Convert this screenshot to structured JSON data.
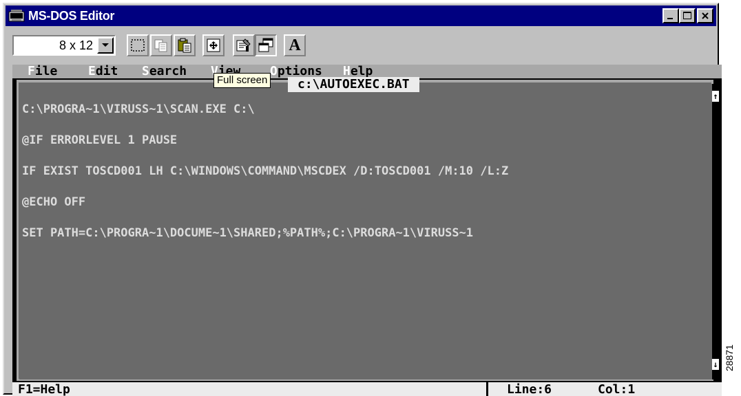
{
  "window": {
    "title": "MS-DOS Editor",
    "icon": "msdos-window-icon",
    "controls": {
      "minimize": "_",
      "maximize": "□",
      "close": "✕"
    }
  },
  "toolbar": {
    "font_size_value": "8 x 12",
    "buttons": [
      {
        "name": "mark-icon"
      },
      {
        "name": "copy-icon"
      },
      {
        "name": "paste-icon"
      },
      {
        "name": "full-screen-icon"
      },
      {
        "name": "properties-icon"
      },
      {
        "name": "background-icon"
      },
      {
        "name": "font-icon",
        "glyph": "A"
      }
    ],
    "tooltip": "Full screen"
  },
  "editor": {
    "menu": [
      {
        "hotkey": "F",
        "rest": "ile"
      },
      {
        "hotkey": "E",
        "rest": "dit"
      },
      {
        "hotkey": "S",
        "rest": "earch"
      },
      {
        "hotkey": "V",
        "rest": "iew"
      },
      {
        "hotkey": "O",
        "rest": "ptions"
      },
      {
        "hotkey": "H",
        "rest": "elp"
      }
    ],
    "file_title": "c:\\AUTOEXEC.BAT",
    "lines": [
      "C:\\PROGRA~1\\VIRUSS~1\\SCAN.EXE C:\\",
      "@IF ERRORLEVEL 1 PAUSE",
      "IF EXIST TOSCD001 LH C:\\WINDOWS\\COMMAND\\MSCDEX /D:TOSCD001 /M:10 /L:Z",
      "@ECHO OFF",
      "SET PATH=C:\\PROGRA~1\\DOCUME~1\\SHARED;%PATH%;C:\\PROGRA~1\\VIRUSS~1"
    ],
    "status": {
      "help": "F1=Help",
      "line": "Line:6",
      "col": "Col:1"
    }
  },
  "figure_id": "28871",
  "colors": {
    "titlebar": "#000080",
    "chrome": "#c0c0c0",
    "editor_bg": "#6a6a6a",
    "menubar": "#a8a8a8"
  }
}
